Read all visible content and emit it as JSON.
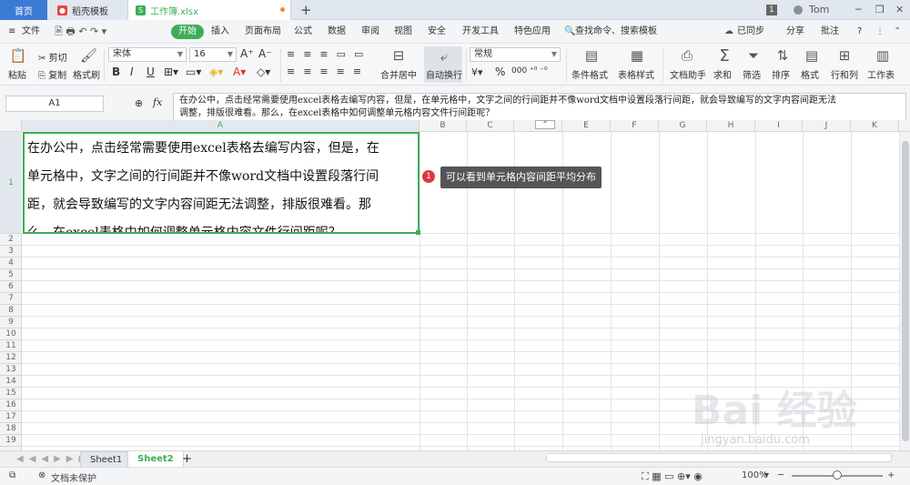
{
  "titlebar": {
    "home_tab": "首页",
    "doc_tab": "稻壳模板",
    "active_tab": "工作簿.xlsx",
    "new_tab": "+",
    "badge": "1",
    "user": "Tom"
  },
  "menubar": {
    "file": "文件",
    "start": "开始",
    "items": [
      "插入",
      "页面布局",
      "公式",
      "数据",
      "审阅",
      "视图",
      "安全",
      "开发工具",
      "特色应用"
    ],
    "search": "查找命令、搜索模板",
    "sync": "已同步",
    "share": "分享",
    "comment": "批注",
    "help": "?"
  },
  "ribbon": {
    "paste": "粘贴",
    "cut": "剪切",
    "copy": "复制",
    "format_painter": "格式刷",
    "font_name": "宋体",
    "font_size": "16",
    "bold": "B",
    "italic": "I",
    "underline": "U",
    "merge": "合并居中",
    "wrap": "自动换行",
    "number_format": "常规",
    "percent": "%",
    "cond_format": "条件格式",
    "table_style": "表格样式",
    "doc_assistant": "文档助手",
    "sum": "求和",
    "filter": "筛选",
    "sort": "排序",
    "format": "格式",
    "rowcol": "行和列",
    "sheet": "工作表"
  },
  "formulabar": {
    "name_box": "A1",
    "fx": "fx",
    "content_line1": "在办公中，点击经常需要使用excel表格去编写内容，但是，在单元格中，文字之间的行间距并不像word文档中设置段落行间距，就会导致编写的文字内容间距无法",
    "content_line2": "调整，排版很难看。那么，在excel表格中如何调整单元格内容文件行间距呢？"
  },
  "columns": [
    "A",
    "B",
    "C",
    "D",
    "E",
    "F",
    "G",
    "H",
    "I",
    "J",
    "K"
  ],
  "rows": [
    "1",
    "2",
    "3",
    "4",
    "5",
    "6",
    "7",
    "8",
    "9",
    "10",
    "11",
    "12",
    "13",
    "14",
    "15",
    "16",
    "17",
    "18",
    "19"
  ],
  "cell_a1": {
    "line1": "在办公中，点击经常需要使用excel表格去编写内容，但是，在",
    "line2": "单元格中，文字之间的行间距并不像word文档中设置段落行间",
    "line3": "距，就会导致编写的文字内容间距无法调整，排版很难看。那",
    "line4": "么，在excel表格中如何调整单元格内容文件行间距呢？"
  },
  "callout": {
    "number": "1",
    "text": "可以看到单元格内容间距平均分布"
  },
  "sheets": [
    "Sheet1",
    "Sheet2"
  ],
  "active_sheet": "Sheet2",
  "status": {
    "protect": "文档未保护",
    "zoom": "100%"
  },
  "watermark": {
    "brand": "Bai 经验",
    "url": "jingyan.baidu.com"
  },
  "colors": {
    "accent_green": "#3dae57",
    "tab_blue": "#3c7bd3",
    "callout_red": "#e0383e"
  }
}
